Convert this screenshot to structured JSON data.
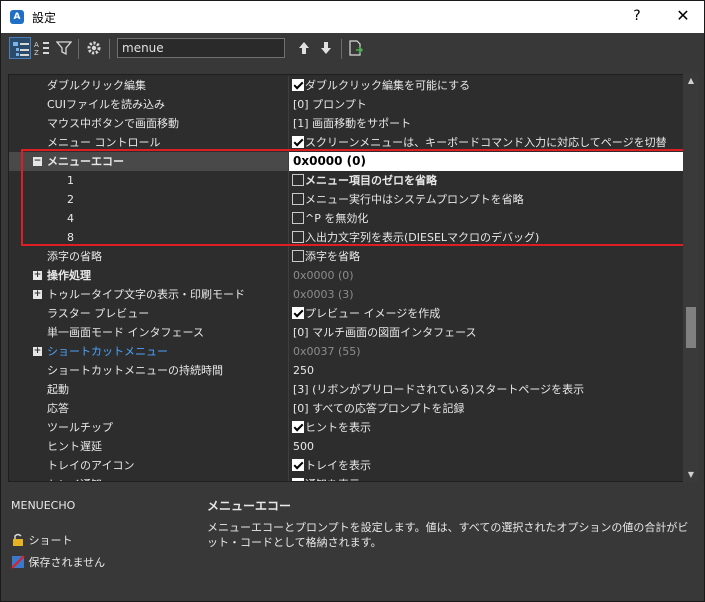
{
  "window": {
    "title": "設定",
    "help_label": "?",
    "close_label": "✕"
  },
  "toolbar": {
    "search_value": "menue",
    "buttons": [
      "categorized-view",
      "alphabetical-view",
      "filter",
      "settings",
      "move-up",
      "move-down",
      "export"
    ]
  },
  "rows": [
    {
      "name": "ダブルクリック編集",
      "value": "ダブルクリック編集を可能にする",
      "checkbox": true,
      "checked": true
    },
    {
      "name": "CUIファイルを読み込み",
      "value": "[0] プロンプト"
    },
    {
      "name": "マウス中ボタンで画面移動",
      "value": "[1] 画面移動をサポート"
    },
    {
      "name": "メニュー コントロール",
      "value": "スクリーンメニューは、キーボードコマンド入力に対応してページを切替",
      "checkbox": true,
      "checked": true
    },
    {
      "name": "メニューエコー",
      "value": "0x0000 (0)",
      "selected": true,
      "expander": "−",
      "bold": true
    },
    {
      "name": "1",
      "value": "メニュー項目のゼロを省略",
      "checkbox": true,
      "checked": false,
      "child": true,
      "valueBold": true
    },
    {
      "name": "2",
      "value": "メニュー実行中はシステムプロンプトを省略",
      "checkbox": true,
      "checked": false,
      "child": true
    },
    {
      "name": "4",
      "value": "^P を無効化",
      "checkbox": true,
      "checked": false,
      "child": true
    },
    {
      "name": "8",
      "value": "入出力文字列を表示(DIESELマクロのデバッグ)",
      "checkbox": true,
      "checked": false,
      "child": true
    },
    {
      "name": "添字の省略",
      "value": "添字を省略",
      "checkbox": true,
      "checked": false
    },
    {
      "name": "操作処理",
      "value": "0x0000 (0)",
      "expander": "+",
      "bold": true,
      "valueGray": true
    },
    {
      "name": "トゥルータイプ文字の表示・印刷モード",
      "value": "0x0003 (3)",
      "expander": "+",
      "valueGray": true
    },
    {
      "name": "ラスター プレビュー",
      "value": "プレビュー イメージを作成",
      "checkbox": true,
      "checked": true
    },
    {
      "name": "単一画面モード インタフェース",
      "value": "[0] マルチ画面の図面インタフェース"
    },
    {
      "name": "ショートカットメニュー",
      "value": "0x0037 (55)",
      "expander": "+",
      "link": true,
      "valueGray": true
    },
    {
      "name": "ショートカットメニューの持続時間",
      "value": "250"
    },
    {
      "name": "起動",
      "value": "[3] (リボンがプリロードされている)スタートページを表示"
    },
    {
      "name": "応答",
      "value": "[0] すべての応答プロンプトを記録"
    },
    {
      "name": "ツールチップ",
      "value": "ヒントを表示",
      "checkbox": true,
      "checked": true
    },
    {
      "name": "ヒント遅延",
      "value": "500"
    },
    {
      "name": "トレイのアイコン",
      "value": "トレイを表示",
      "checkbox": true,
      "checked": true
    },
    {
      "name": "トレイ通知",
      "value": "通知を表示",
      "checkbox": true,
      "checked": true
    }
  ],
  "footer": {
    "variable": "MENUECHO",
    "legend": [
      {
        "icon": "lock-icon",
        "label": "ショート"
      },
      {
        "icon": "not-saved-icon",
        "label": "保存されません"
      }
    ],
    "desc_title": "メニューエコー",
    "desc_text": "メニューエコーとプロンプトを設定します。値は、すべての選択されたオプションの値の合計がビット・コードとして格納されます。"
  },
  "colors": {
    "highlight": "#e11d24",
    "link": "#4da3ff",
    "background": "#383838"
  }
}
